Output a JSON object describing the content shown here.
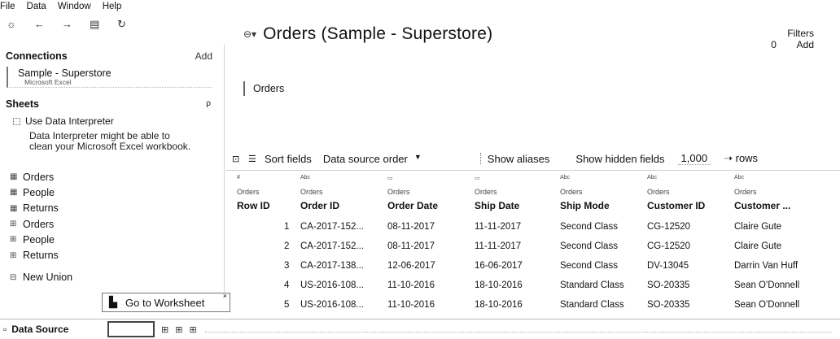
{
  "menu": [
    "File",
    "Data",
    "Window",
    "Help"
  ],
  "toolbar_icons": [
    "☼",
    "←",
    "→",
    "▤",
    "↻"
  ],
  "connections": {
    "title": "Connections",
    "add": "Add",
    "source_name": "Sample - Superstore",
    "source_type": "Microsoft Excel"
  },
  "sheets": {
    "title": "Sheets",
    "search_icon": "ρ",
    "interpreter_label": "Use Data Interpreter",
    "interpreter_text": "Data Interpreter might be able to clean your Microsoft Excel workbook.",
    "items": [
      {
        "icon": "▦",
        "label": "Orders"
      },
      {
        "icon": "▦",
        "label": "People"
      },
      {
        "icon": "▦",
        "label": "Returns"
      },
      {
        "icon": "⊞",
        "label": "Orders"
      },
      {
        "icon": "⊞",
        "label": "People"
      },
      {
        "icon": "⊞",
        "label": "Returns"
      }
    ],
    "new_union": "New Union"
  },
  "main": {
    "ds_icon": "⊖▾",
    "title": "Orders (Sample - Superstore)",
    "filters_label": "Filters",
    "filters_count": "0",
    "filters_add": "Add",
    "canvas_table": "Orders"
  },
  "grid_toolbar": {
    "sort_label": "Sort fields",
    "sort_value": "Data source order",
    "show_aliases": "Show aliases",
    "show_hidden": "Show hidden fields",
    "rows_value": "1,000",
    "rows_label": "rows"
  },
  "grid": {
    "columns": [
      {
        "type": "#",
        "source": "Orders",
        "header": "Row ID"
      },
      {
        "type": "Abc",
        "source": "Orders",
        "header": "Order ID"
      },
      {
        "type": "▭",
        "source": "Orders",
        "header": "Order Date"
      },
      {
        "type": "▭",
        "source": "Orders",
        "header": "Ship Date"
      },
      {
        "type": "Abc",
        "source": "Orders",
        "header": "Ship Mode"
      },
      {
        "type": "Abc",
        "source": "Orders",
        "header": "Customer ID"
      },
      {
        "type": "Abc",
        "source": "Orders",
        "header": "Customer ..."
      }
    ],
    "rows": [
      [
        "1",
        "CA-2017-152...",
        "08-11-2017",
        "11-11-2017",
        "Second Class",
        "CG-12520",
        "Claire Gute"
      ],
      [
        "2",
        "CA-2017-152...",
        "08-11-2017",
        "11-11-2017",
        "Second Class",
        "CG-12520",
        "Claire Gute"
      ],
      [
        "3",
        "CA-2017-138...",
        "12-06-2017",
        "16-06-2017",
        "Second Class",
        "DV-13045",
        "Darrin Van Huff"
      ],
      [
        "4",
        "US-2016-108...",
        "11-10-2016",
        "18-10-2016",
        "Standard Class",
        "SO-20335",
        "Sean O'Donnell"
      ],
      [
        "5",
        "US-2016-108...",
        "11-10-2016",
        "18-10-2016",
        "Standard Class",
        "SO-20335",
        "Sean O'Donnell"
      ]
    ]
  },
  "tooltip": {
    "icon": "▙",
    "label": "Go to Worksheet",
    "close": "×"
  },
  "bottom": {
    "ds_icon": "▫",
    "ds_label": "Data Source",
    "new_icons": [
      "⊞",
      "⊞",
      "⊞"
    ]
  }
}
